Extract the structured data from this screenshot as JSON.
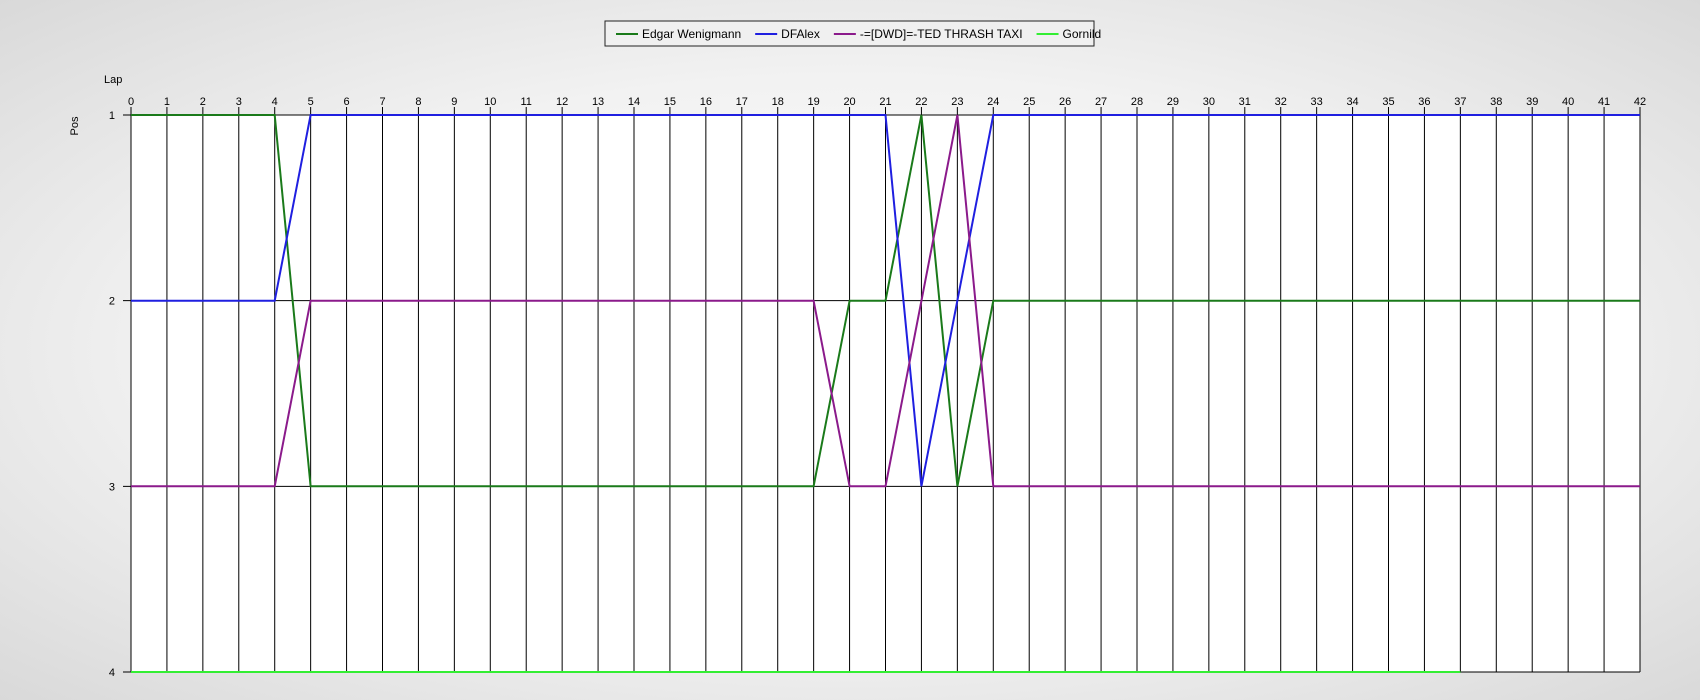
{
  "chart_data": {
    "type": "line",
    "xlabel": "Lap",
    "ylabel": "Pos",
    "xlim": [
      0,
      42
    ],
    "ylim": [
      1,
      4
    ],
    "y_inverted": true,
    "grid": "vertical lines at every lap",
    "legend_position": "top-center",
    "x_ticks": [
      0,
      1,
      2,
      3,
      4,
      5,
      6,
      7,
      8,
      9,
      10,
      11,
      12,
      13,
      14,
      15,
      16,
      17,
      18,
      19,
      20,
      21,
      22,
      23,
      24,
      25,
      26,
      27,
      28,
      29,
      30,
      31,
      32,
      33,
      34,
      35,
      36,
      37,
      38,
      39,
      40,
      41,
      42
    ],
    "y_ticks": [
      1,
      2,
      3,
      4
    ],
    "series": [
      {
        "name": "Edgar Wenigmann",
        "color": "#1a7a1a",
        "points": [
          [
            0,
            1
          ],
          [
            4,
            1
          ],
          [
            5,
            3
          ],
          [
            19,
            3
          ],
          [
            20,
            2
          ],
          [
            21,
            2
          ],
          [
            22,
            1
          ],
          [
            23,
            3
          ],
          [
            24,
            2
          ],
          [
            42,
            2
          ]
        ]
      },
      {
        "name": "DFAlex",
        "color": "#1f1fe0",
        "points": [
          [
            0,
            2
          ],
          [
            4,
            2
          ],
          [
            5,
            1
          ],
          [
            21,
            1
          ],
          [
            22,
            3
          ],
          [
            24,
            1
          ],
          [
            42,
            1
          ]
        ]
      },
      {
        "name": "-=[DWD]=-TED THRASH TAXI",
        "color": "#8b1a8b",
        "points": [
          [
            0,
            3
          ],
          [
            4,
            3
          ],
          [
            5,
            2
          ],
          [
            19,
            2
          ],
          [
            20,
            3
          ],
          [
            21,
            3
          ],
          [
            23,
            1
          ],
          [
            24,
            3
          ],
          [
            42,
            3
          ]
        ]
      },
      {
        "name": "Gornild",
        "color": "#33ee33",
        "points": [
          [
            0,
            4
          ],
          [
            37,
            4
          ]
        ]
      }
    ]
  }
}
